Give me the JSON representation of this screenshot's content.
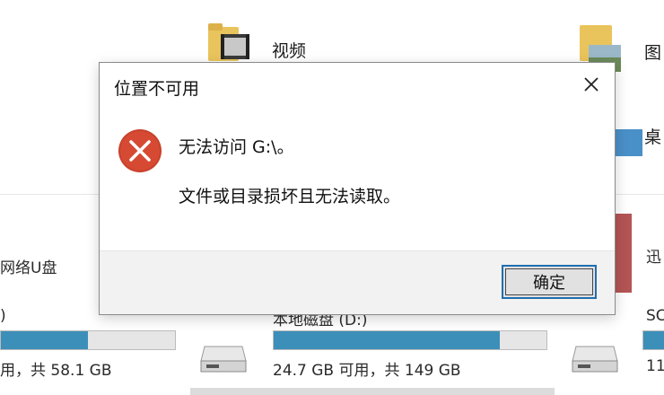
{
  "background": {
    "videos_label": "视频",
    "pictures_label_partial": "图",
    "desktop_label_partial": "桌",
    "network_drive_label_partial": "网络U盘",
    "left_drive_paren": ")",
    "left_drive_free_text": "用，共 58.1 GB",
    "left_drive_usage": 0.5,
    "local_disk_label": "本地磁盘 (D:)",
    "local_disk_free_text": "24.7 GB 可用，共 149 GB",
    "local_disk_usage": 0.83,
    "right_item_label_partial": "迅",
    "right_drive_label_partial": "SC",
    "right_drive_free_partial": "11"
  },
  "dialog": {
    "title": "位置不可用",
    "message_main": "无法访问 G:\\。",
    "message_detail": "文件或目录损坏且无法读取。",
    "ok_label": "确定"
  },
  "colors": {
    "accent": "#1f6fb0",
    "usage_bar": "#3c8fb8",
    "error_red": "#c8412c"
  }
}
